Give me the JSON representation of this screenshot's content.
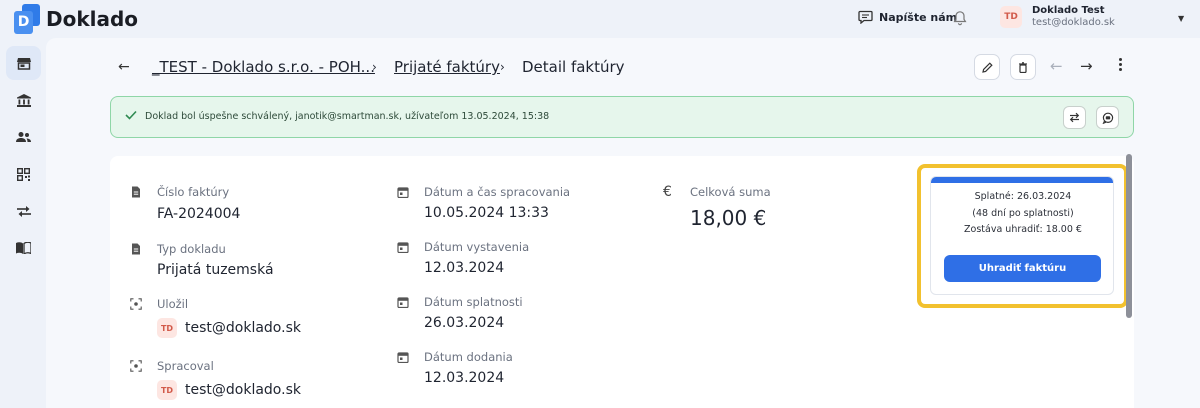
{
  "app": {
    "name": "Doklado",
    "logo_letter": "D"
  },
  "header": {
    "write_us": "Napíšte nám",
    "user": {
      "initials": "TD",
      "name": "Doklado Test",
      "email": "test@doklado.sk"
    }
  },
  "sidebar": {
    "items": [
      {
        "icon": "store-icon",
        "active": true
      },
      {
        "icon": "bank-icon",
        "active": false
      },
      {
        "icon": "users-icon",
        "active": false
      },
      {
        "icon": "qr-code-icon",
        "active": false
      },
      {
        "icon": "transfer-icon",
        "active": false
      },
      {
        "icon": "book-icon",
        "active": false
      }
    ]
  },
  "breadcrumb": {
    "company": "_TEST - Doklado s.r.o. - POH...",
    "section": "Prijaté faktúry",
    "current": "Detail faktúry",
    "separator": "›"
  },
  "alert": {
    "text": "Doklad bol úspešne schválený, janotik@smartman.sk, užívateľom 13.05.2024, 15:38"
  },
  "invoice": {
    "number_label": "Číslo faktúry",
    "number": "FA-2024004",
    "type_label": "Typ dokladu",
    "type": "Prijatá tuzemská",
    "saved_by_label": "Uložil",
    "saved_by": {
      "initials": "TD",
      "email": "test@doklado.sk"
    },
    "processed_by_label": "Spracoval",
    "processed_by": {
      "initials": "TD",
      "email": "test@doklado.sk"
    },
    "processed_at_label": "Dátum a čas spracovania",
    "processed_at": "10.05.2024 13:33",
    "issued_label": "Dátum vystavenia",
    "issued": "12.03.2024",
    "due_label": "Dátum splatnosti",
    "due": "26.03.2024",
    "delivery_label": "Dátum dodania",
    "delivery": "12.03.2024",
    "total_label": "Celková suma",
    "total": "18,00 €",
    "currency_symbol": "€"
  },
  "payment": {
    "due_line": "Splatné:  26.03.2024",
    "overdue_line": "(48 dní po splatnosti)",
    "remaining_line": "Zostáva uhradiť:  18.00 €",
    "pay_button": "Uhradiť faktúru"
  },
  "colors": {
    "accent": "#2f6fe6",
    "success_bg": "#e6f6ec",
    "success_border": "#8fd6a7",
    "highlight": "#f2c12e"
  }
}
